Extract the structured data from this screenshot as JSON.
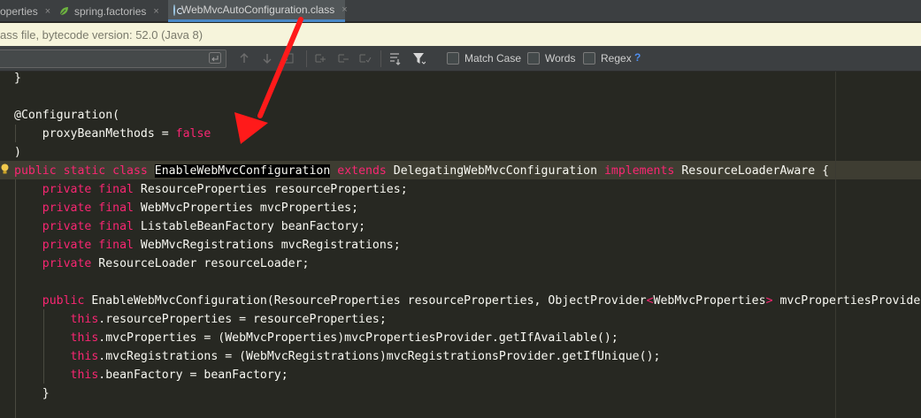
{
  "tabs": [
    {
      "label": "operties",
      "icon": "properties-icon",
      "active": false
    },
    {
      "label": "spring.factories",
      "icon": "spring-leaf-icon",
      "active": false
    },
    {
      "label": "WebMvcAutoConfiguration.class",
      "icon": "class-file-icon",
      "active": true
    }
  ],
  "tab_close_glyph": "×",
  "banner": {
    "text": "ass file, bytecode version: 52.0 (Java 8)"
  },
  "search": {
    "value": "",
    "options": {
      "match_case": "Match Case",
      "words": "Words",
      "regex": "Regex"
    },
    "help": "?"
  },
  "editor": {
    "lines": [
      {
        "tokens": [
          [
            "pn",
            "}"
          ]
        ]
      },
      {
        "tokens": []
      },
      {
        "tokens": [
          [
            "an",
            "@Configuration("
          ]
        ]
      },
      {
        "tokens": [
          [
            "pn",
            "    proxyBeanMethods = "
          ],
          [
            "bool",
            "false"
          ]
        ]
      },
      {
        "tokens": [
          [
            "pn",
            ")"
          ]
        ]
      },
      {
        "tokens": [
          [
            "kw",
            "public static class "
          ],
          [
            "sel",
            "EnableWebMvcConfiguration"
          ],
          [
            "pn",
            " "
          ],
          [
            "kw",
            "extends"
          ],
          [
            "pn",
            " DelegatingWebMvcConfiguration "
          ],
          [
            "kw",
            "implements"
          ],
          [
            "pn",
            " ResourceLoaderAware {"
          ]
        ]
      },
      {
        "tokens": [
          [
            "kw",
            "    private final "
          ],
          [
            "ty",
            "ResourceProperties resourceProperties"
          ],
          [
            "pn",
            ";"
          ]
        ]
      },
      {
        "tokens": [
          [
            "kw",
            "    private final "
          ],
          [
            "ty",
            "WebMvcProperties mvcProperties"
          ],
          [
            "pn",
            ";"
          ]
        ]
      },
      {
        "tokens": [
          [
            "kw",
            "    private final "
          ],
          [
            "ty",
            "ListableBeanFactory beanFactory"
          ],
          [
            "pn",
            ";"
          ]
        ]
      },
      {
        "tokens": [
          [
            "kw",
            "    private final "
          ],
          [
            "ty",
            "WebMvcRegistrations mvcRegistrations"
          ],
          [
            "pn",
            ";"
          ]
        ]
      },
      {
        "tokens": [
          [
            "kw",
            "    private "
          ],
          [
            "ty",
            "ResourceLoader resourceLoader"
          ],
          [
            "pn",
            ";"
          ]
        ]
      },
      {
        "tokens": []
      },
      {
        "tokens": [
          [
            "kw",
            "    public "
          ],
          [
            "pn",
            "EnableWebMvcConfiguration(ResourceProperties resourceProperties, ObjectProvider"
          ],
          [
            "kw",
            "<"
          ],
          [
            "pn",
            "WebMvcProperties"
          ],
          [
            "kw",
            ">"
          ],
          [
            "pn",
            " mvcPropertiesProvide"
          ]
        ]
      },
      {
        "tokens": [
          [
            "kw",
            "        this"
          ],
          [
            "pn",
            ".resourceProperties = resourceProperties;"
          ]
        ]
      },
      {
        "tokens": [
          [
            "kw",
            "        this"
          ],
          [
            "pn",
            ".mvcProperties = (WebMvcProperties)mvcPropertiesProvider.getIfAvailable();"
          ]
        ]
      },
      {
        "tokens": [
          [
            "kw",
            "        this"
          ],
          [
            "pn",
            ".mvcRegistrations = (WebMvcRegistrations)mvcRegistrationsProvider.getIfUnique();"
          ]
        ]
      },
      {
        "tokens": [
          [
            "kw",
            "        this"
          ],
          [
            "pn",
            ".beanFactory = beanFactory;"
          ]
        ]
      },
      {
        "tokens": [
          [
            "pn",
            "    }"
          ]
        ]
      }
    ]
  },
  "colors": {
    "keyword": "#f92672",
    "text": "#f8f8f2",
    "editor_bg": "#272822",
    "current_line_bg": "#3e3d32",
    "annotation_arrow": "#ff1a1a"
  }
}
